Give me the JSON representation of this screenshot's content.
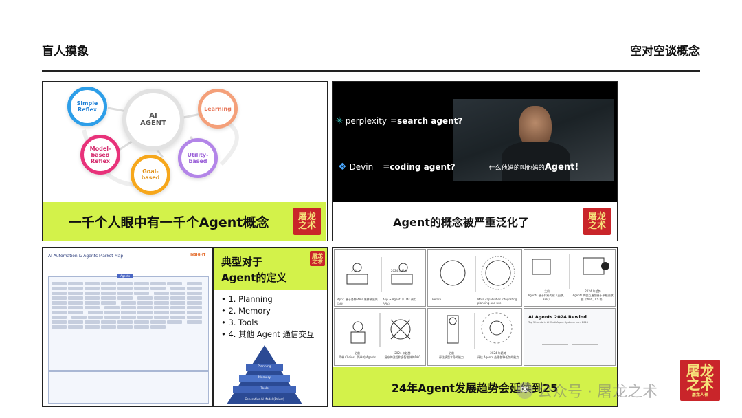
{
  "header": {
    "left": "盲人摸象",
    "right": "空对空谈概念"
  },
  "panel_tl": {
    "center": "AI\nAGENT",
    "nodes": {
      "simple": "Simple\nReflex",
      "learning": "Learning",
      "model": "Model-\nbased\nReflex",
      "utility": "Utility-\nbased",
      "goal": "Goal-\nbased"
    },
    "caption": "一千个人眼中有一千个Agent概念"
  },
  "panel_tr": {
    "perplexity_brand": "perplexity",
    "perplexity_label": "=search agent?",
    "devin_brand": "Devin",
    "devin_label": "=coding agent?",
    "subtitle_prefix": "什么他妈的叫他妈的",
    "subtitle_agent": "Agent!",
    "caption": "Agent的概念被严重泛化了"
  },
  "panel_bl": {
    "map_title": "AI Automation & Agents Market Map",
    "map_brand": "INSIGHT",
    "map_center": "Agents",
    "def_title": "典型对于\nAgent的定义",
    "def_items": [
      "1. Planning",
      "2. Memory",
      "3. Tools",
      "4. 其他 Agent 通信交互"
    ],
    "pyramid": [
      "Planning",
      "Memory",
      "Tools",
      "Generative AI Model (Driver)"
    ]
  },
  "panel_br": {
    "sketch1_top_left": "之前",
    "sketch1_top_right": "2024 年趋势",
    "sketch1_caption_left": "App：基于各种 APIs 来拼装出来功能",
    "sketch1_caption_right": "App → Agent（LLMs 调用 APIs）",
    "sketch2_caption_left": "Before",
    "sketch2_caption_right": "More capabilities integrating, planning and use",
    "sketch3_left_title": "之前",
    "sketch3_left_caption": "Agents 基于代码构建（函数、APIs）",
    "sketch3_right_title": "2024 年趋势",
    "sketch3_right_caption": "Agents 的交互更加基于多模态数据（Web、CS 等）",
    "sketch4_left_title": "之前",
    "sketch4_left_caption": "简单 Chains、简单的 Agents",
    "sketch4_right_title": "2024 年趋势",
    "sketch4_right_caption": "复杂的流程和多智能体的DAG",
    "sketch5_left_title": "之前",
    "sketch5_left_caption": "评估模型本身的能力",
    "sketch5_right_title": "2024 年趋势",
    "sketch5_right_caption": "评估 Agents 处理各种任务的能力",
    "rewind_title": "AI Agents 2024 Rewind",
    "rewind_subtitle": "Top 5 trends in AI Multi-Agent Systems from 2024",
    "caption": "24年Agent发展趋势会延续到25"
  },
  "seal": {
    "line1": "屠龙",
    "line2": "之术",
    "small": "屠龙人禅"
  },
  "watermark": {
    "icon": "wechat-icon",
    "label": "公众号 · 屠龙之术"
  },
  "colors": {
    "accent_green": "#d3f24a",
    "seal_red": "#c9252a"
  }
}
